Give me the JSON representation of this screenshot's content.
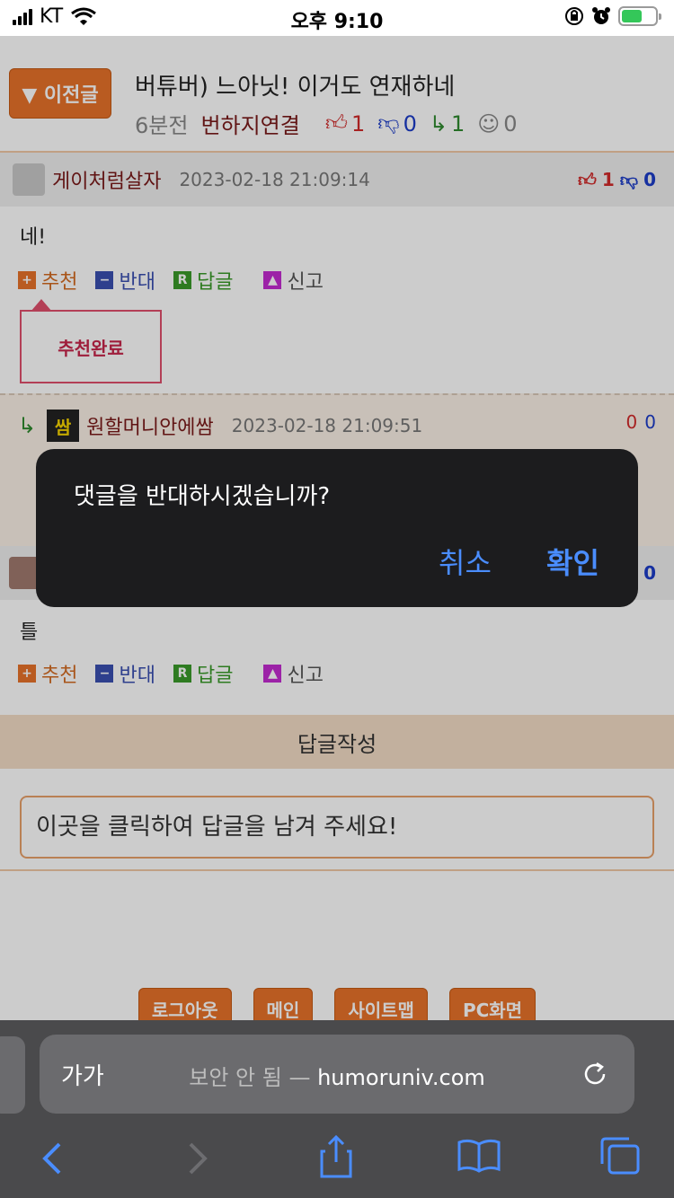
{
  "status_bar": {
    "carrier": "KT",
    "time": "오후 9:10",
    "battery_color": "#34c759"
  },
  "post": {
    "prev_button": "▼ 이전글",
    "title": "버튜버) 느아닛! 이거도 연재하네",
    "time_ago": "6분전",
    "author_link": "번하지연결",
    "up_count": "1",
    "down_count": "0",
    "reply_count": "1",
    "neutral_count": "0"
  },
  "comments": [
    {
      "nickname": "게이처럼살자",
      "date": "2023-02-18 21:09:14",
      "up": "1",
      "down": "0",
      "body": "네!",
      "actions": {
        "recommend": "추천",
        "oppose": "반대",
        "reply": "답글",
        "report": "신고"
      },
      "popup": "추천완료"
    },
    {
      "nickname": "원할머니안에쌈",
      "date": "2023-02-18 21:09:51",
      "up": "0",
      "down": "0"
    },
    {
      "down": "0",
      "body": "틀",
      "actions": {
        "recommend": "추천",
        "oppose": "반대",
        "reply": "답글",
        "report": "신고"
      }
    }
  ],
  "reply_form": {
    "header": "답글작성",
    "placeholder": "이곳을 클릭하여 답글을 남겨 주세요!"
  },
  "footer": {
    "buttons": [
      "로그아웃",
      "메인",
      "사이트맵",
      "PC화면"
    ]
  },
  "alert": {
    "message": "댓글을 반대하시겠습니까?",
    "cancel": "취소",
    "confirm": "확인"
  },
  "browser": {
    "text_size": "가가",
    "security": "보안 안 됨",
    "separator": "—",
    "domain": "humoruniv.com"
  },
  "colors": {
    "accent_orange": "#e8722a",
    "alert_bg": "#1c1c1e",
    "alert_button": "#4a8dff"
  }
}
